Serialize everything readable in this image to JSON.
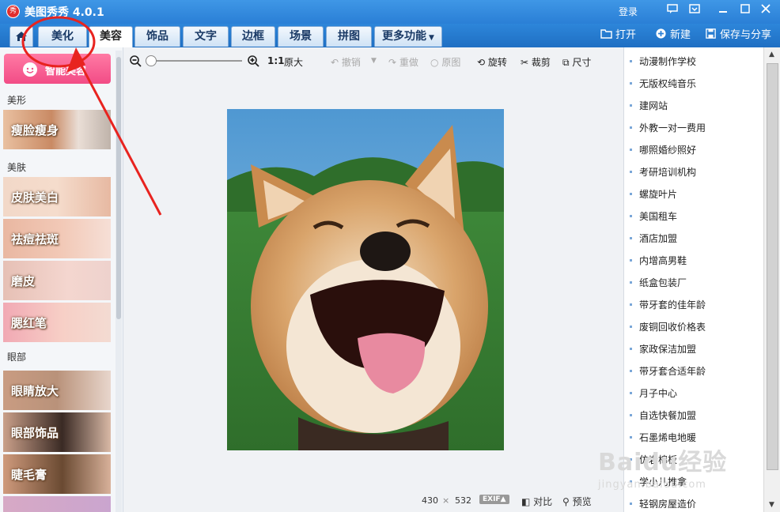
{
  "titlebar": {
    "logo_text": "秀",
    "app_title": "美图秀秀 4.0.1",
    "login": "登录"
  },
  "tabs": [
    "美化",
    "美容",
    "饰品",
    "文字",
    "边框",
    "场景",
    "拼图",
    "更多功能"
  ],
  "active_tab": "美容",
  "right_tools": {
    "open": "打开",
    "new": "新建",
    "save_share": "保存与分享"
  },
  "left_panel": {
    "smart_beauty": "智能美容",
    "sections": {
      "shape": "美形",
      "skin": "美肤",
      "eyes": "眼部"
    },
    "items": {
      "face_slim": "瘦脸瘦身",
      "skin_whiten": "皮肤美白",
      "acne_remove": "祛痘祛斑",
      "smooth": "磨皮",
      "blush": "腮红笔",
      "eye_enlarge": "眼睛放大",
      "eye_deco": "眼部饰品",
      "mascara": "睫毛膏"
    }
  },
  "toolbar": {
    "ratio": "1:1",
    "original_size": "原大",
    "undo": "撤销",
    "redo": "重做",
    "original": "原图",
    "rotate": "旋转",
    "crop": "裁剪",
    "size": "尺寸"
  },
  "status": {
    "width": "430",
    "times": "×",
    "height": "532",
    "exif": "EXIF",
    "compare": "对比",
    "preview": "预览"
  },
  "ads": [
    "动漫制作学校",
    "无版权纯音乐",
    "建网站",
    "外教一对一费用",
    "哪照婚纱照好",
    "考研培训机构",
    "螺旋叶片",
    "美国租车",
    "酒店加盟",
    "内增高男鞋",
    "纸盒包装厂",
    "带牙套的佳年龄",
    "废铜回收价格表",
    "家政保洁加盟",
    "带牙套合适年龄",
    "月子中心",
    "自选快餐加盟",
    "石墨烯电地暖",
    "仿岩棉板",
    "学小儿推拿",
    "轻钢房屋造价"
  ],
  "watermark": {
    "brand": "Baidu经验",
    "url": "jingyan.baidu.com"
  },
  "colors": {
    "title_blue": "#2a7fd6",
    "smart_pink": "#f24c86",
    "annotation_red": "#e8231f"
  }
}
